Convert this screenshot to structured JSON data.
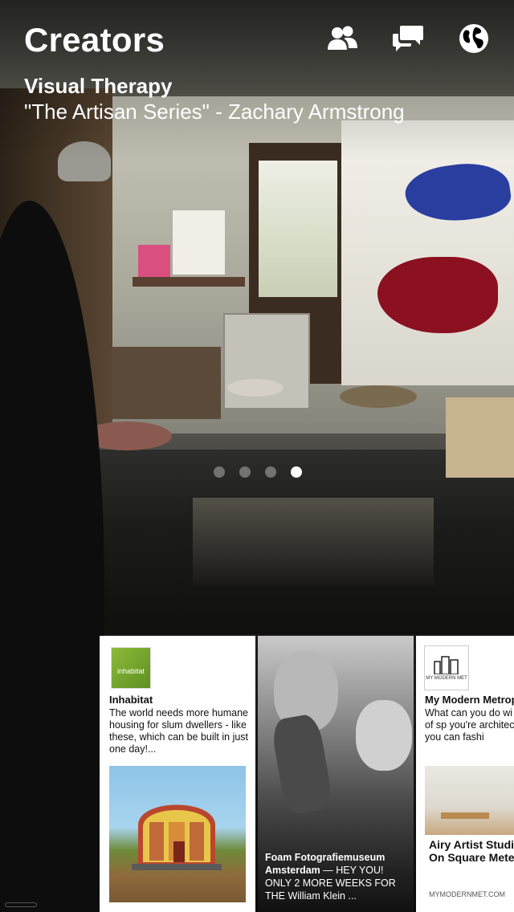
{
  "header": {
    "title": "Creators",
    "icons": [
      "people-icon",
      "chat-bubbles-icon",
      "globe-icon"
    ]
  },
  "feature": {
    "category": "Visual Therapy",
    "caption": "\"The Artisan Series\" - Zachary Armstrong",
    "page_count": 4,
    "active_page": 4
  },
  "cards": [
    {
      "logo_text": "inhabitat",
      "source": "Inhabitat",
      "blurb": "The world needs more humane housing for slum dwellers - like these, which can be built in just one day!..."
    },
    {
      "source_bold": "Foam Fotografiemuseum Amsterdam",
      "text": " — HEY YOU! ONLY 2 MORE WEEKS FOR THE William Klein ..."
    },
    {
      "logo_text": "MY MODERN MET",
      "source": "My Modern Metrop",
      "blurb": "What can you do wi square meters of sp you're architect Raa Stern, you can fashi",
      "headline": "Airy Artist Studi Larger Than On Square Meters",
      "domain": "MYMODERNMET.COM"
    }
  ],
  "colors": {
    "header_text": "#ffffff",
    "dot_active": "#ffffff",
    "dot_inactive": "rgba(255,255,255,0.35)"
  }
}
